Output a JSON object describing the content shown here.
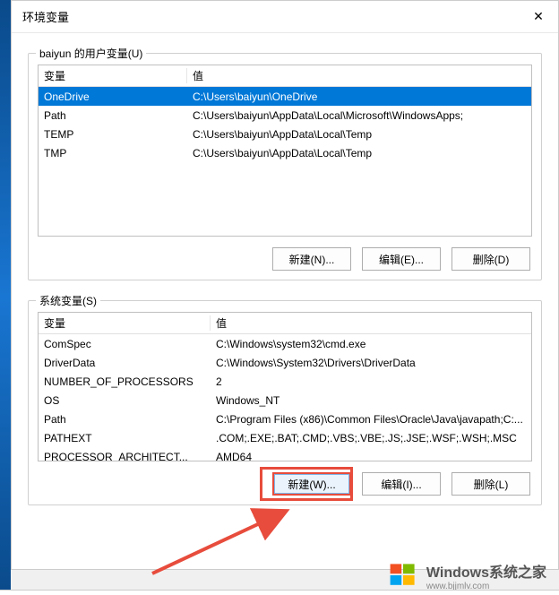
{
  "dialog": {
    "title": "环境变量",
    "close_icon": "✕"
  },
  "user_section": {
    "legend": "baiyun 的用户变量(U)",
    "headers": {
      "variable": "变量",
      "value": "值"
    },
    "rows": [
      {
        "name": "OneDrive",
        "value": "C:\\Users\\baiyun\\OneDrive",
        "selected": true
      },
      {
        "name": "Path",
        "value": "C:\\Users\\baiyun\\AppData\\Local\\Microsoft\\WindowsApps;",
        "selected": false
      },
      {
        "name": "TEMP",
        "value": "C:\\Users\\baiyun\\AppData\\Local\\Temp",
        "selected": false
      },
      {
        "name": "TMP",
        "value": "C:\\Users\\baiyun\\AppData\\Local\\Temp",
        "selected": false
      }
    ],
    "buttons": {
      "new": "新建(N)...",
      "edit": "编辑(E)...",
      "delete": "删除(D)"
    }
  },
  "system_section": {
    "legend": "系统变量(S)",
    "headers": {
      "variable": "变量",
      "value": "值"
    },
    "rows": [
      {
        "name": "ComSpec",
        "value": "C:\\Windows\\system32\\cmd.exe"
      },
      {
        "name": "DriverData",
        "value": "C:\\Windows\\System32\\Drivers\\DriverData"
      },
      {
        "name": "NUMBER_OF_PROCESSORS",
        "value": "2"
      },
      {
        "name": "OS",
        "value": "Windows_NT"
      },
      {
        "name": "Path",
        "value": "C:\\Program Files (x86)\\Common Files\\Oracle\\Java\\javapath;C:..."
      },
      {
        "name": "PATHEXT",
        "value": ".COM;.EXE;.BAT;.CMD;.VBS;.VBE;.JS;.JSE;.WSF;.WSH;.MSC"
      },
      {
        "name": "PROCESSOR_ARCHITECT...",
        "value": "AMD64"
      }
    ],
    "buttons": {
      "new": "新建(W)...",
      "edit": "编辑(I)...",
      "delete": "删除(L)"
    }
  },
  "watermark": {
    "brand": "Windows系统之家",
    "url": "www.bjjmlv.com"
  }
}
